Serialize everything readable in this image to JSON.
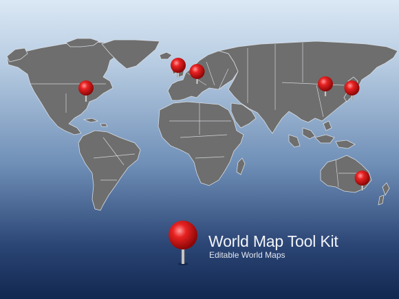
{
  "title": "World Map  Tool Kit",
  "subtitle": "Editable World Maps",
  "pins": [
    "new-york",
    "london",
    "berlin",
    "beijing",
    "tokyo",
    "sydney"
  ],
  "colors": {
    "land": "#6e6e6e",
    "pin": "#e01818",
    "background_top": "#dbe8f5",
    "background_bottom": "#112850"
  }
}
